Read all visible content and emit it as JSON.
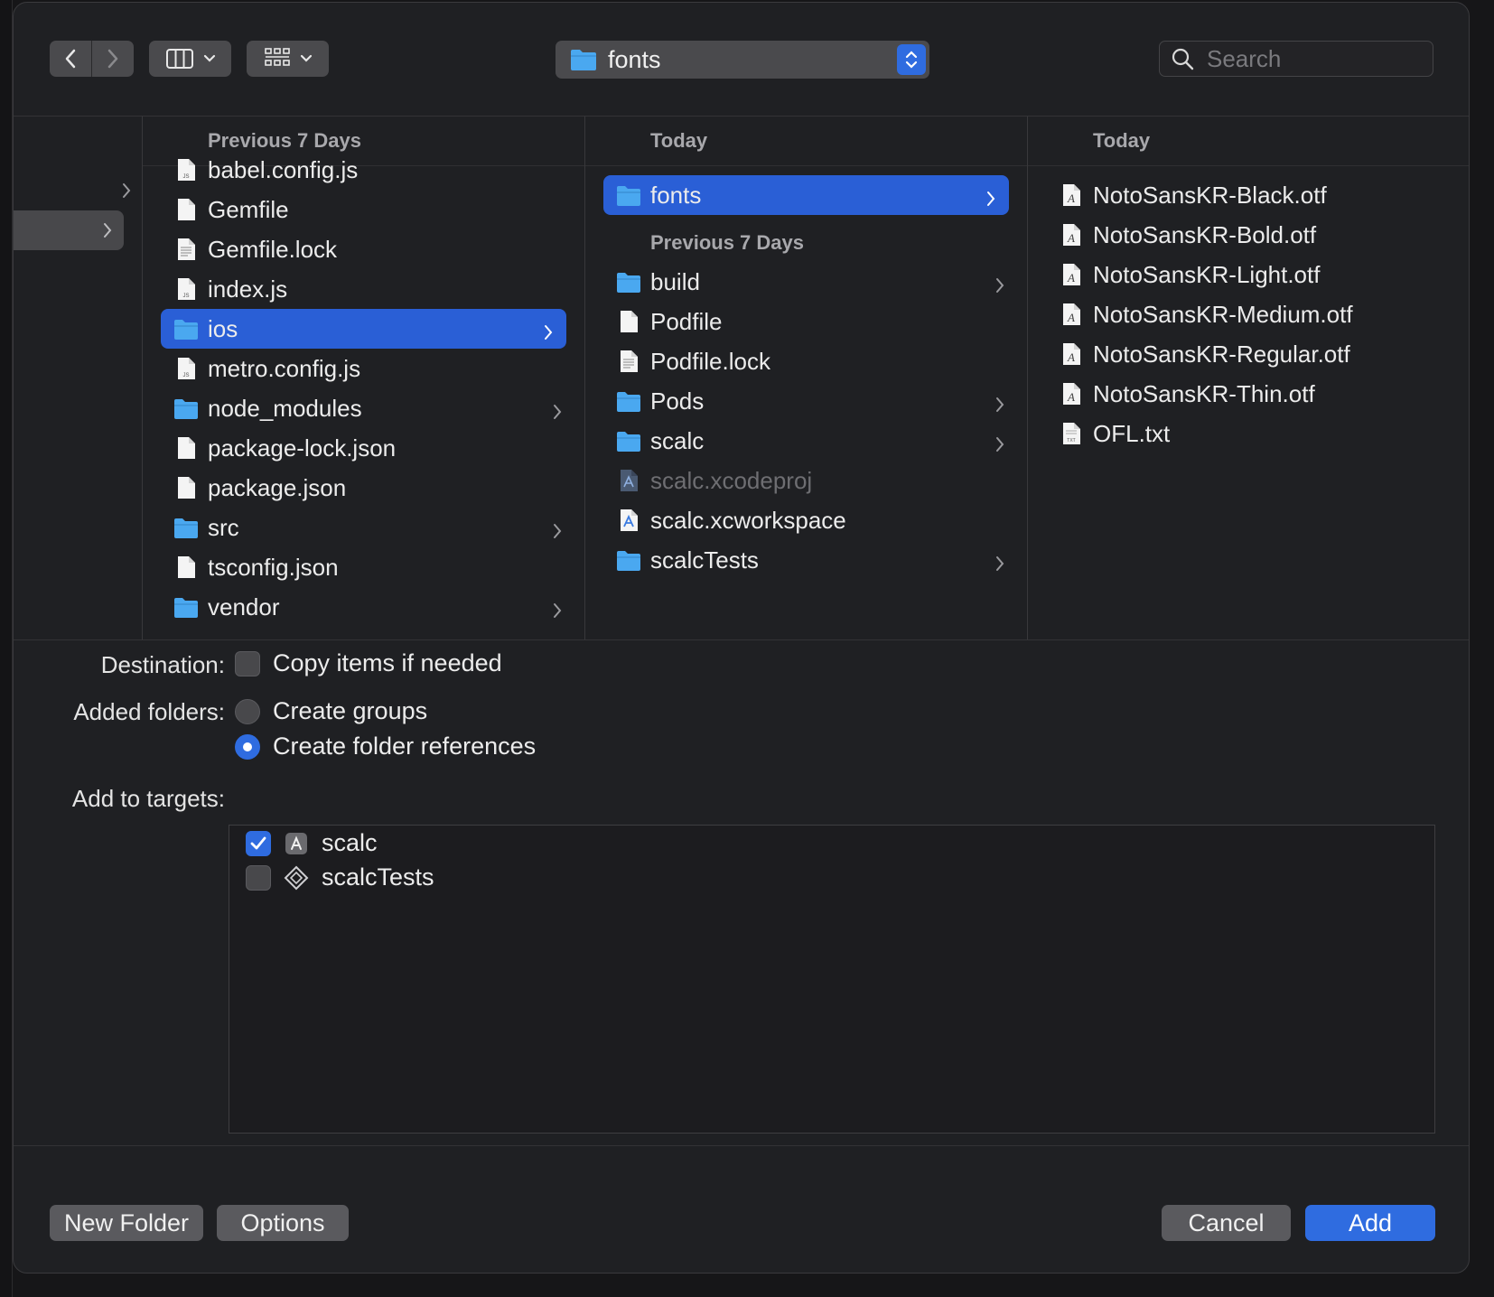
{
  "toolbar": {
    "path_label": "fonts",
    "search_placeholder": "Search"
  },
  "columns": {
    "col1": {
      "header": "Previous 7 Days",
      "items": [
        {
          "name": "babel.config.js",
          "kind": "js-file-icon",
          "folder": false
        },
        {
          "name": "Gemfile",
          "kind": "file-icon",
          "folder": false
        },
        {
          "name": "Gemfile.lock",
          "kind": "text-file-icon",
          "folder": false
        },
        {
          "name": "index.js",
          "kind": "js-file-icon",
          "folder": false
        },
        {
          "name": "ios",
          "kind": "folder-icon",
          "folder": true,
          "selected": true
        },
        {
          "name": "metro.config.js",
          "kind": "js-file-icon",
          "folder": false
        },
        {
          "name": "node_modules",
          "kind": "folder-icon",
          "folder": true
        },
        {
          "name": "package-lock.json",
          "kind": "file-icon",
          "folder": false
        },
        {
          "name": "package.json",
          "kind": "file-icon",
          "folder": false
        },
        {
          "name": "src",
          "kind": "folder-icon",
          "folder": true
        },
        {
          "name": "tsconfig.json",
          "kind": "file-icon",
          "folder": false
        },
        {
          "name": "vendor",
          "kind": "folder-icon",
          "folder": true
        }
      ]
    },
    "col2": {
      "header": "Today",
      "today_items": [
        {
          "name": "fonts",
          "kind": "folder-icon",
          "folder": true,
          "selected": true
        }
      ],
      "section_header": "Previous 7 Days",
      "items": [
        {
          "name": "build",
          "kind": "folder-icon",
          "folder": true
        },
        {
          "name": "Podfile",
          "kind": "file-icon",
          "folder": false
        },
        {
          "name": "Podfile.lock",
          "kind": "text-file-icon",
          "folder": false
        },
        {
          "name": "Pods",
          "kind": "folder-icon",
          "folder": true
        },
        {
          "name": "scalc",
          "kind": "folder-icon",
          "folder": true
        },
        {
          "name": "scalc.xcodeproj",
          "kind": "xcodeproj-icon",
          "folder": false,
          "dim": true
        },
        {
          "name": "scalc.xcworkspace",
          "kind": "xcworkspace-icon",
          "folder": false
        },
        {
          "name": "scalcTests",
          "kind": "folder-icon",
          "folder": true
        }
      ]
    },
    "col3": {
      "header": "Today",
      "items": [
        {
          "name": "NotoSansKR-Black.otf",
          "kind": "font-file-icon"
        },
        {
          "name": "NotoSansKR-Bold.otf",
          "kind": "font-file-icon"
        },
        {
          "name": "NotoSansKR-Light.otf",
          "kind": "font-file-icon"
        },
        {
          "name": "NotoSansKR-Medium.otf",
          "kind": "font-file-icon"
        },
        {
          "name": "NotoSansKR-Regular.otf",
          "kind": "font-file-icon"
        },
        {
          "name": "NotoSansKR-Thin.otf",
          "kind": "font-file-icon"
        },
        {
          "name": "OFL.txt",
          "kind": "txt-file-icon"
        }
      ]
    }
  },
  "options": {
    "destination_label": "Destination:",
    "copy_items_label": "Copy items if needed",
    "copy_items_checked": false,
    "added_folders_label": "Added folders:",
    "create_groups_label": "Create groups",
    "create_folder_refs_label": "Create folder references",
    "selected_folder_option": "create_folder_references",
    "add_to_targets_label": "Add to targets:",
    "targets": [
      {
        "name": "scalc",
        "checked": true,
        "icon": "app-target-icon"
      },
      {
        "name": "scalcTests",
        "checked": false,
        "icon": "test-target-icon"
      }
    ]
  },
  "footer": {
    "new_folder": "New Folder",
    "options": "Options",
    "cancel": "Cancel",
    "add": "Add"
  },
  "colors": {
    "accent": "#2f6ce0",
    "selection": "#2a5fd6",
    "folder": "#4aa8f0"
  }
}
